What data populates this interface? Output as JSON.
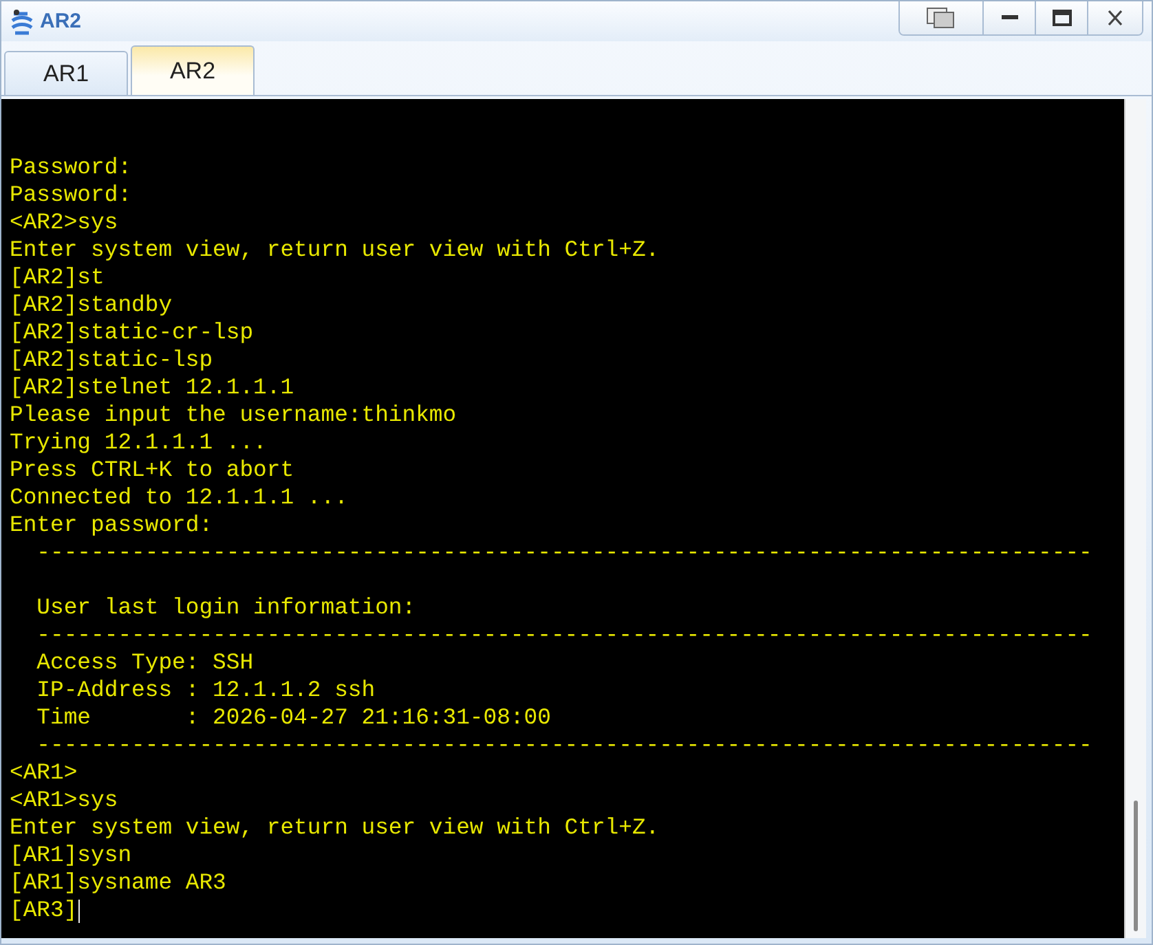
{
  "window": {
    "title": "AR2"
  },
  "tabs": [
    {
      "label": "AR1",
      "selected": false
    },
    {
      "label": "AR2",
      "selected": true
    }
  ],
  "terminal": {
    "blocks": [
      [
        "Password:",
        "Password:",
        "<AR2>sys",
        "Enter system view, return user view with Ctrl+Z.",
        "[AR2]st",
        "[AR2]standby",
        "[AR2]static-cr-lsp",
        "[AR2]static-lsp",
        "[AR2]stelnet 12.1.1.1",
        "Please input the username:thinkmo",
        "Trying 12.1.1.1 ...",
        "Press CTRL+K to abort",
        "Connected to 12.1.1.1 ...",
        "Enter password:",
        "  ------------------------------------------------------------------------------"
      ],
      [
        "  User last login information:",
        "  ------------------------------------------------------------------------------",
        "  Access Type: SSH",
        "  IP-Address : 12.1.1.2 ssh",
        "  Time       : 2026-04-27 21:16:31-08:00",
        "  ------------------------------------------------------------------------------",
        "<AR1>",
        "<AR1>sys",
        "Enter system view, return user view with Ctrl+Z.",
        "[AR1]sysn",
        "[AR1]sysname AR3",
        "[AR3]"
      ]
    ]
  }
}
